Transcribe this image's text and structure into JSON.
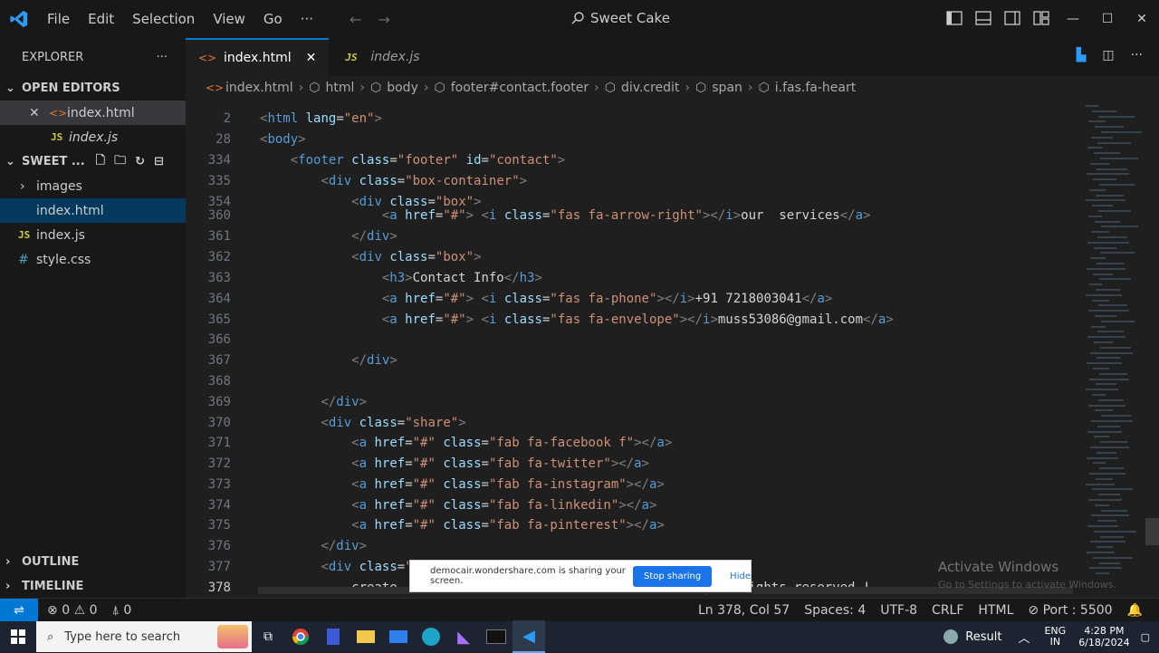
{
  "menu": {
    "file": "File",
    "edit": "Edit",
    "selection": "Selection",
    "view": "View",
    "go": "Go",
    "more": "···"
  },
  "command_center": {
    "title": "Sweet Cake"
  },
  "sidebar": {
    "header": "EXPLORER",
    "open_editors_label": "OPEN EDITORS",
    "open_editors": [
      {
        "name": "index.html",
        "type": "html"
      },
      {
        "name": "index.js",
        "type": "js"
      }
    ],
    "folder_label": "SWEET ...",
    "files": [
      {
        "name": "images",
        "type": "folder"
      },
      {
        "name": "index.html",
        "type": "html"
      },
      {
        "name": "index.js",
        "type": "js"
      },
      {
        "name": "style.css",
        "type": "css"
      }
    ],
    "outline_label": "OUTLINE",
    "timeline_label": "TIMELINE"
  },
  "tabs": [
    {
      "label": "index.html"
    },
    {
      "label": "index.js"
    }
  ],
  "breadcrumb": [
    "index.html",
    "html",
    "body",
    "footer#contact.footer",
    "div.credit",
    "span",
    "i.fas.fa-heart"
  ],
  "code_lines": [
    {
      "n": "2",
      "text": "<html lang=\"en\">"
    },
    {
      "n": "28",
      "text": "<body>"
    },
    {
      "n": "334",
      "text": "    <footer class=\"footer\" id=\"contact\">"
    },
    {
      "n": "335",
      "text": "        <div class=\"box-container\">"
    },
    {
      "n": "354",
      "text": "            <div class=\"box\">"
    },
    {
      "n": "360",
      "text": "                <a href=\"#\"> <i class=\"fas fa-arrow-right\"></i>our  services</a>"
    },
    {
      "n": "361",
      "text": "            </div>"
    },
    {
      "n": "362",
      "text": "            <div class=\"box\">"
    },
    {
      "n": "363",
      "text": "                <h3>Contact Info</h3>"
    },
    {
      "n": "364",
      "text": "                <a href=\"#\"> <i class=\"fas fa-phone\"></i>+91 7218003041</a>"
    },
    {
      "n": "365",
      "text": "                <a href=\"#\"> <i class=\"fas fa-envelope\"></i>muss53086@gmail.com</a>"
    },
    {
      "n": "366",
      "text": ""
    },
    {
      "n": "367",
      "text": "            </div>"
    },
    {
      "n": "368",
      "text": ""
    },
    {
      "n": "369",
      "text": "        </div>"
    },
    {
      "n": "370",
      "text": "        <div class=\"share\">"
    },
    {
      "n": "371",
      "text": "            <a href=\"#\" class=\"fab fa-facebook f\"></a>"
    },
    {
      "n": "372",
      "text": "            <a href=\"#\" class=\"fab fa-twitter\"></a>"
    },
    {
      "n": "373",
      "text": "            <a href=\"#\" class=\"fab fa-instagram\"></a>"
    },
    {
      "n": "374",
      "text": "            <a href=\"#\" class=\"fab fa-linkedin\"></a>"
    },
    {
      "n": "375",
      "text": "            <a href=\"#\" class=\"fab fa-pinterest\"></a>"
    },
    {
      "n": "376",
      "text": "        </div>"
    },
    {
      "n": "377",
      "text": "        <div class=\"credit\">"
    },
    {
      "n": "378",
      "text": "            create                           </i> </span> |all rights reserved !"
    }
  ],
  "share_notice": {
    "message": "democair.wondershare.com is sharing your screen.",
    "stop": "Stop sharing",
    "hide": "Hide"
  },
  "watermark": {
    "line1": "Activate Windows",
    "line2": "Go to Settings to activate Windows."
  },
  "status": {
    "errors": "0",
    "warnings": "0",
    "ports": "0",
    "position": "Ln 378, Col 57",
    "spaces": "Spaces: 4",
    "encoding": "UTF-8",
    "eol": "CRLF",
    "language": "HTML",
    "port": "Port : 5500"
  },
  "taskbar": {
    "search_placeholder": "Type here to search",
    "result": "Result",
    "lang1": "ENG",
    "lang2": "IN",
    "time": "4:28 PM",
    "date": "6/18/2024"
  },
  "colors": {
    "accent": "#0078d4",
    "tag": "#569cd6",
    "attr": "#9cdcfe",
    "string": "#ce9178"
  }
}
